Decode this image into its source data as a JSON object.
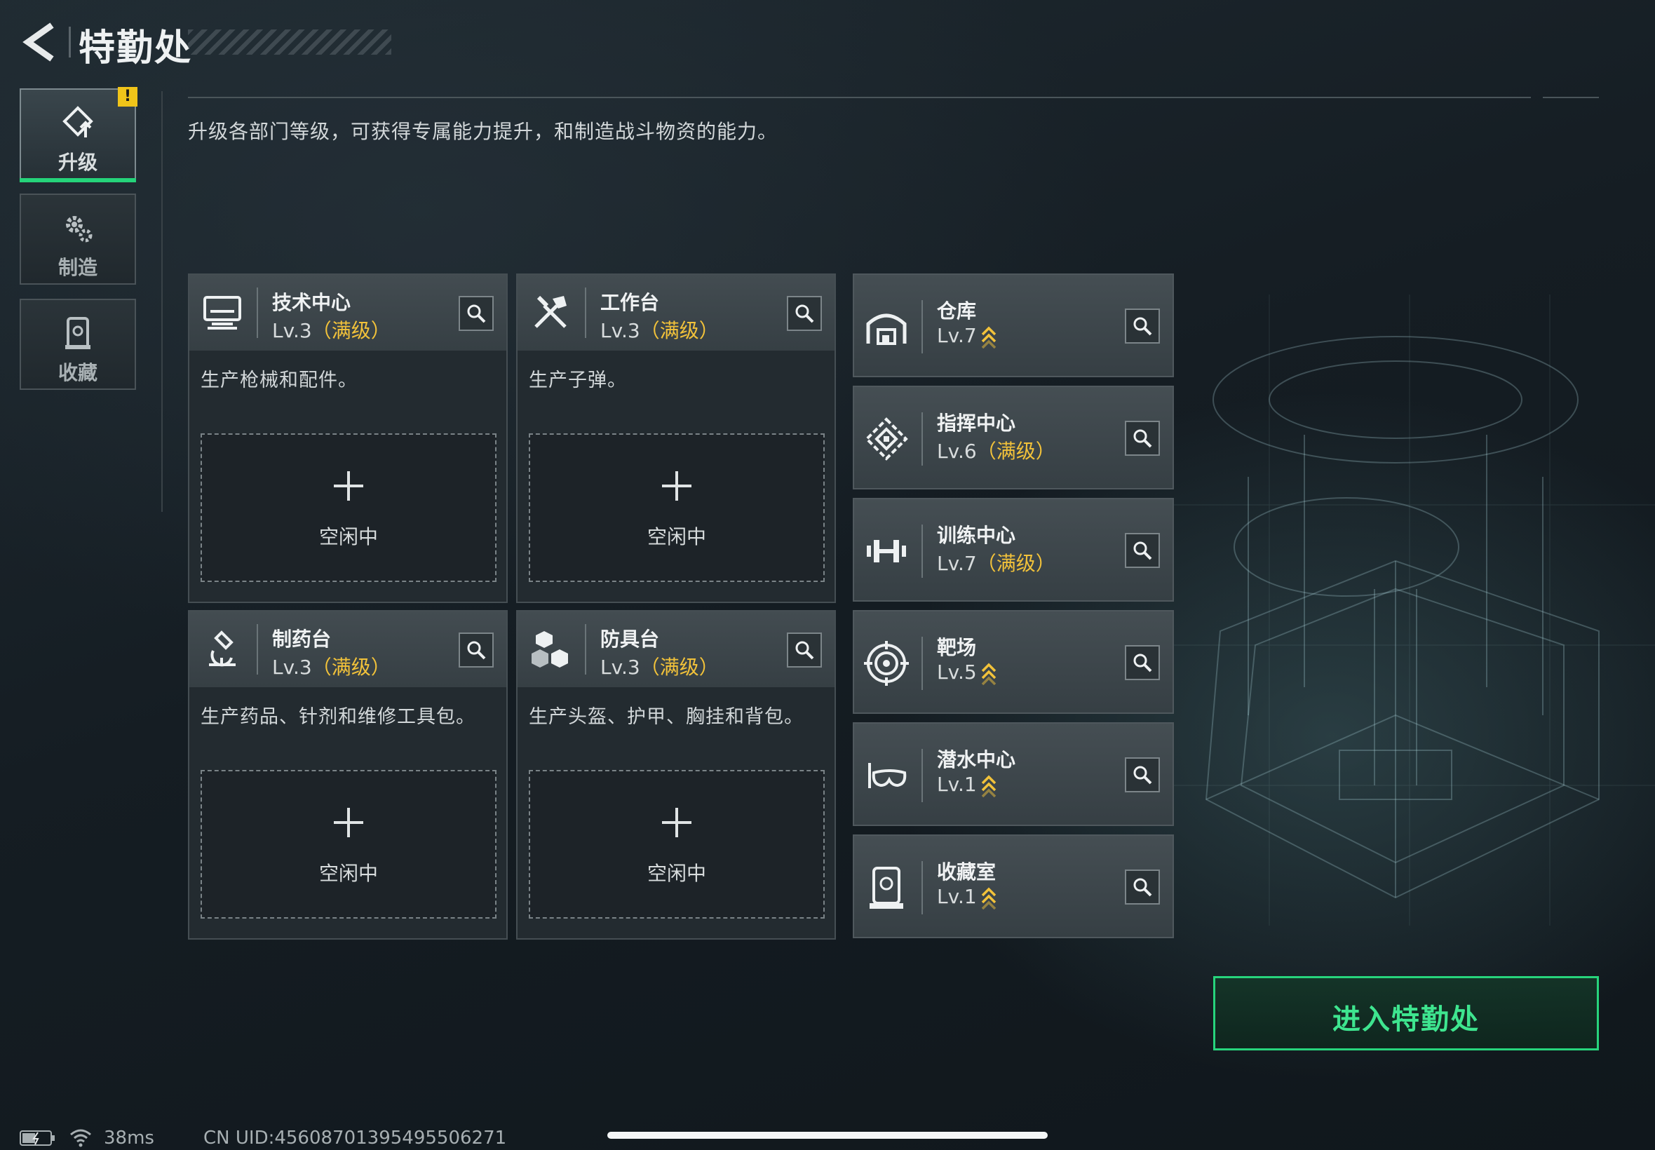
{
  "header": {
    "title": "特勤处"
  },
  "sidebar": {
    "items": [
      {
        "label": "升级",
        "icon": "upgrade-icon",
        "active": true,
        "badge": "!"
      },
      {
        "label": "制造",
        "icon": "gears-icon",
        "active": false
      },
      {
        "label": "收藏",
        "icon": "collection-icon",
        "active": false
      }
    ]
  },
  "description": "升级各部门等级，可获得专属能力提升，和制造战斗物资的能力。",
  "workshops": [
    {
      "name": "技术中心",
      "level": "Lv.3",
      "max": "（满级）",
      "desc": "生产枪械和配件。",
      "slot": "空闲中",
      "icon": "computer-icon"
    },
    {
      "name": "工作台",
      "level": "Lv.3",
      "max": "（满级）",
      "desc": "生产子弹。",
      "slot": "空闲中",
      "icon": "tools-icon"
    },
    {
      "name": "制药台",
      "level": "Lv.3",
      "max": "（满级）",
      "desc": "生产药品、针剂和维修工具包。",
      "slot": "空闲中",
      "icon": "microscope-icon"
    },
    {
      "name": "防具台",
      "level": "Lv.3",
      "max": "（满级）",
      "desc": "生产头盔、护甲、胸挂和背包。",
      "slot": "空闲中",
      "icon": "armor-blocks-icon"
    }
  ],
  "facilities": [
    {
      "name": "仓库",
      "level": "Lv.7",
      "max": "",
      "upgradable": true,
      "icon": "warehouse-icon"
    },
    {
      "name": "指挥中心",
      "level": "Lv.6",
      "max": "（满级）",
      "upgradable": false,
      "icon": "command-icon"
    },
    {
      "name": "训练中心",
      "level": "Lv.7",
      "max": "（满级）",
      "upgradable": false,
      "icon": "dumbbell-icon"
    },
    {
      "name": "靶场",
      "level": "Lv.5",
      "max": "",
      "upgradable": true,
      "icon": "target-icon"
    },
    {
      "name": "潜水中心",
      "level": "Lv.1",
      "max": "",
      "upgradable": true,
      "icon": "diving-mask-icon"
    },
    {
      "name": "收藏室",
      "level": "Lv.1",
      "max": "",
      "upgradable": true,
      "icon": "trophy-room-icon"
    }
  ],
  "enter_button": "进入特勤处",
  "status": {
    "ping": "38ms",
    "uid": "CN UID:456087013954955062​71"
  },
  "colors": {
    "accent": "#27d47c",
    "max_level": "#f2c23a",
    "warning": "#f0c419"
  }
}
